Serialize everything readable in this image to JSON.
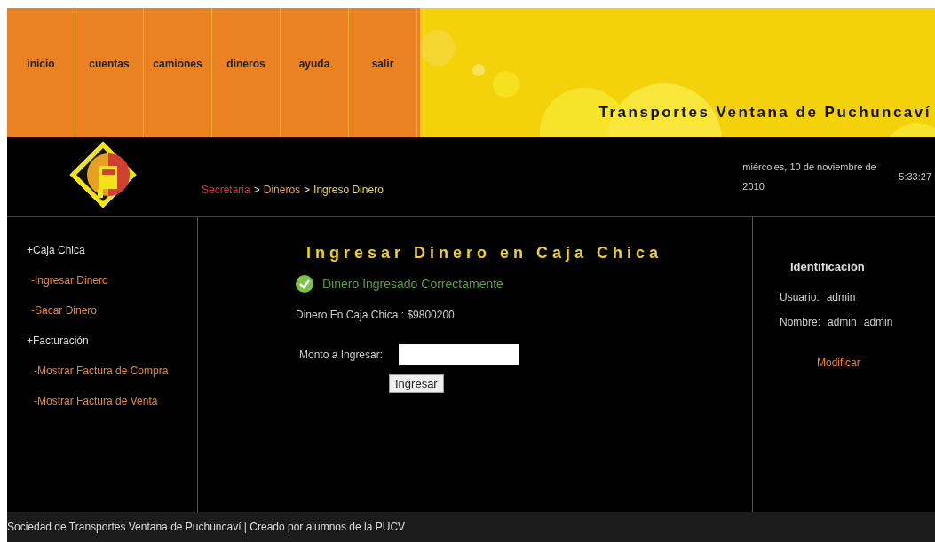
{
  "nav": [
    {
      "label": "inicio"
    },
    {
      "label": "cuentas"
    },
    {
      "label": "camiones"
    },
    {
      "label": "dineros"
    },
    {
      "label": "ayuda"
    },
    {
      "label": "salir"
    }
  ],
  "site_title": "Transportes Ventana de Puchuncaví",
  "breadcrumb": {
    "separator": ">",
    "items": [
      {
        "label": "Secretaria",
        "color": "#d6323a"
      },
      {
        "label": "Dineros",
        "color": "#e8a05a"
      },
      {
        "label": "Ingreso Dinero",
        "color": "#e8d84a"
      }
    ]
  },
  "date": "miércoles, 10 de noviembre de 2010",
  "time": "5:33:27",
  "sidebar": [
    {
      "label": "+Caja Chica",
      "children": [
        {
          "label": "-Ingresar Dinero"
        },
        {
          "label": "-Sacar Dinero"
        }
      ]
    },
    {
      "label": "+Facturación",
      "children": [
        {
          "label": "-Mostrar Factura de Compra"
        },
        {
          "label": "-Mostrar Factura de Venta"
        }
      ]
    }
  ],
  "form": {
    "title": "Ingresar Dinero en Caja Chica",
    "success_message": "Dinero Ingresado Correctamente",
    "balance": "Dinero En Caja Chica : $9800200",
    "amount_label": "Monto a Ingresar:",
    "submit": "Ingresar"
  },
  "identification": {
    "title": "Identificación",
    "rows": [
      {
        "label": "Usuario:",
        "values": [
          "admin"
        ]
      },
      {
        "label": "Nombre:",
        "values": [
          "admin",
          "admin"
        ]
      }
    ],
    "link": "Modificar"
  },
  "footer": "Sociedad de Transportes Ventana de Puchuncaví | Creado por alumnos de la PUCV"
}
